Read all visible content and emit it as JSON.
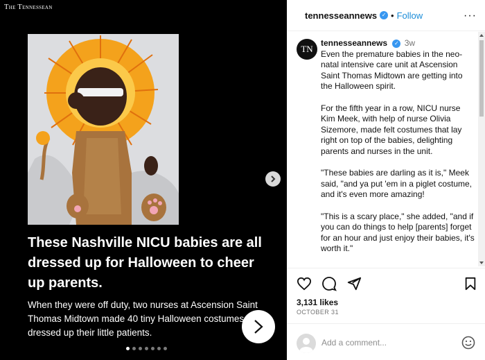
{
  "media": {
    "brand": "The Tennessean",
    "headline": "These Nashville NICU babies are all dressed up for Halloween to cheer up parents.",
    "subtext": "When they were off duty, two nurses at Ascension Saint Thomas Midtown made 40 tiny Halloween costumes and dressed up their little patients.",
    "slide_count": 7,
    "active_slide": 1
  },
  "header": {
    "username": "tennesseannews",
    "separator": "•",
    "follow_label": "Follow",
    "more_label": "···"
  },
  "post": {
    "avatar_text": "TN",
    "username": "tennesseannews",
    "time": "3w",
    "paragraphs": [
      "Even the premature babies in the neo-natal intensive care unit at Ascension Saint Thomas Midtown are getting into the Halloween spirit.",
      "For the fifth year in a row, NICU nurse Kim Meek, with help of nurse Olivia Sizemore, made felt costumes that lay right on top of the babies, delighting parents and nurses in the unit.",
      "\"These babies are darling as it is,\" Meek said, \"and ya put 'em in a piglet costume, and it's even more amazing!",
      "\"This is a scary place,\" she added, \"and if you can do things to help [parents] forget for an hour and just enjoy their babies, it's worth it.\""
    ],
    "likes": "3,131 likes",
    "date": "October 31"
  },
  "comment": {
    "placeholder": "Add a comment..."
  },
  "icons": {
    "verified": "verified-badge-icon",
    "like": "heart-icon",
    "comment": "comment-bubble-icon",
    "share": "paper-plane-icon",
    "save": "bookmark-icon",
    "emoji": "smiley-icon",
    "next": "chevron-right-icon"
  },
  "colors": {
    "media_bg": "#000000",
    "link_blue": "#1a8cd8",
    "verified_blue": "#3897f0",
    "muted": "#737373"
  }
}
